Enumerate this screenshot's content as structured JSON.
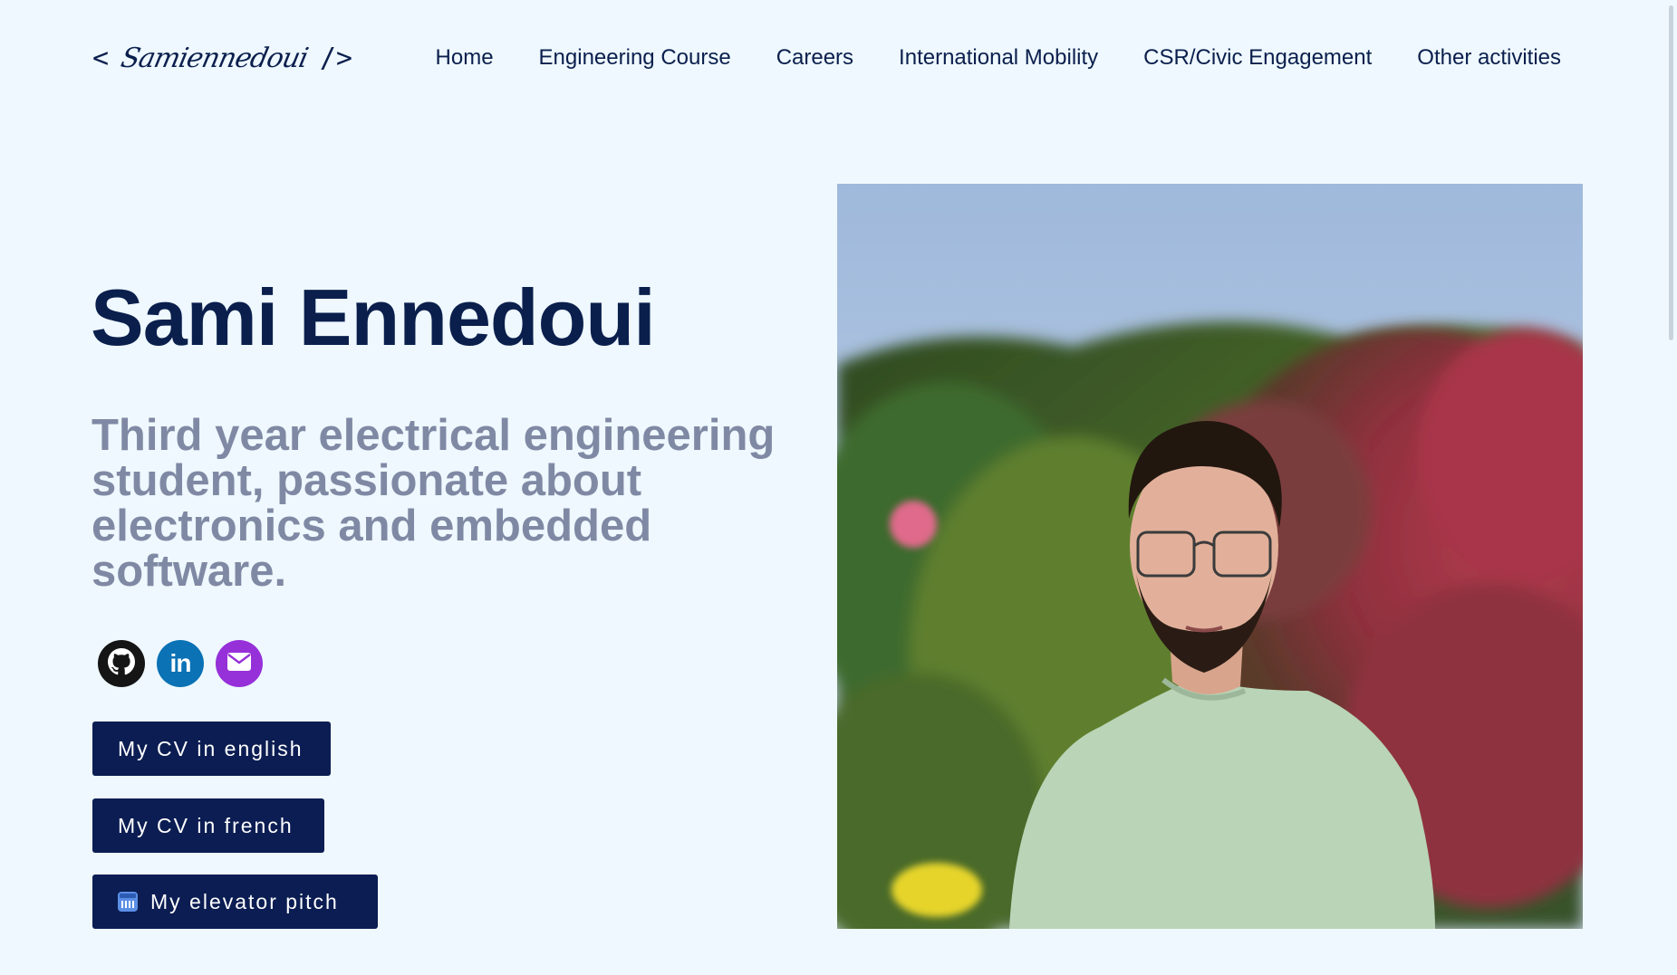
{
  "header": {
    "logo": {
      "open": "<",
      "signature": "Samiennedoui",
      "close": "/>"
    },
    "nav": [
      {
        "label": "Home"
      },
      {
        "label": "Engineering Course"
      },
      {
        "label": "Careers"
      },
      {
        "label": "International Mobility"
      },
      {
        "label": "CSR/Civic Engagement"
      },
      {
        "label": "Other activities"
      }
    ]
  },
  "hero": {
    "name": "Sami Ennedoui",
    "tagline": "Third year electrical engineering student, passionate about electronics and embedded software.",
    "socials": [
      {
        "name": "github",
        "icon": "github-icon",
        "color": "#151515"
      },
      {
        "name": "linkedin",
        "icon": "linkedin-icon",
        "text": "in",
        "color": "#0a72b5"
      },
      {
        "name": "email",
        "icon": "envelope-icon",
        "color": "#9630d9"
      }
    ],
    "buttons": {
      "cv_english": "My CV in english",
      "cv_french": "My CV in french",
      "elevator_pitch": "My elevator pitch"
    }
  },
  "colors": {
    "background": "#eef8fe",
    "primary": "#0b1d52",
    "tagline": "#8089a4"
  }
}
